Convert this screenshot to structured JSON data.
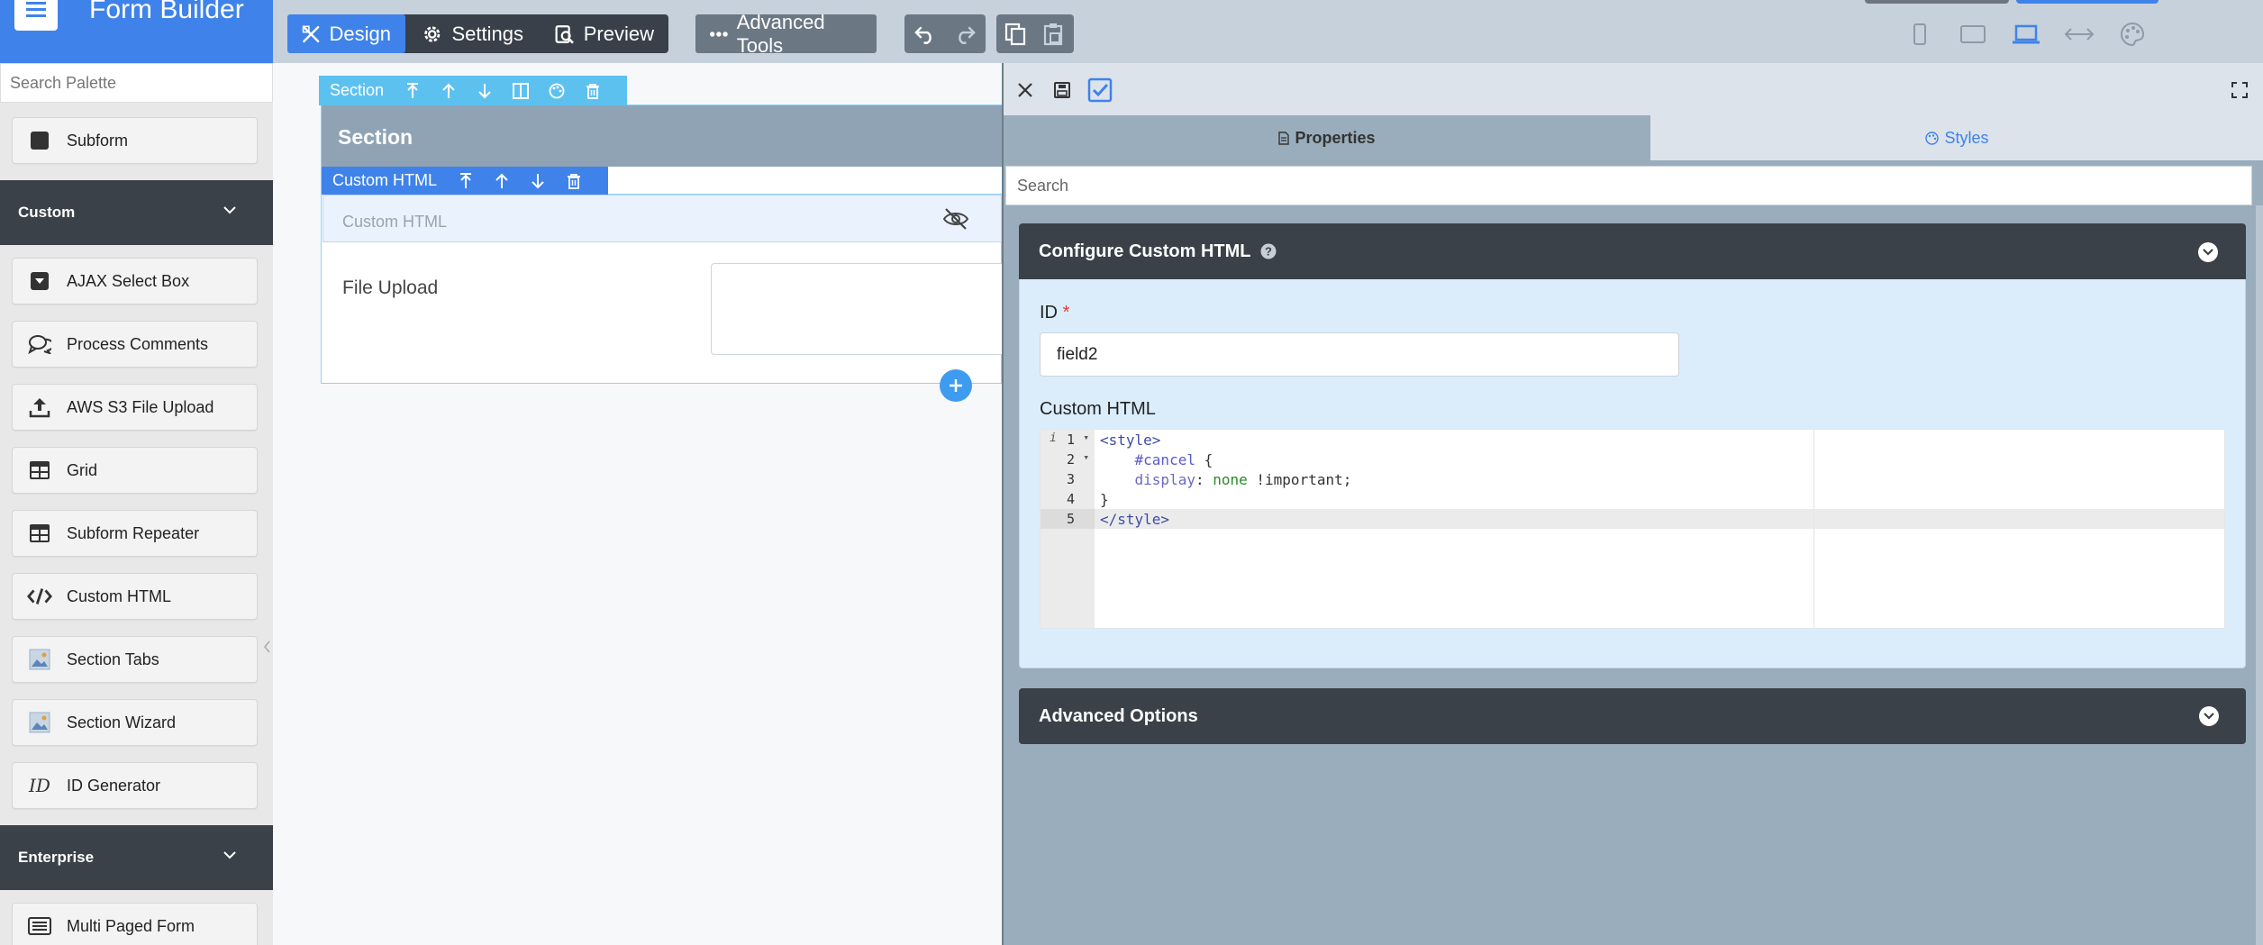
{
  "app": {
    "title": "Form Builder",
    "accent_color": "#3f83ea"
  },
  "header": {
    "design_label": "Design",
    "settings_label": "Settings",
    "preview_label": "Preview",
    "advanced_tools_label": "Advanced Tools",
    "device_icons": [
      "phone-icon",
      "tablet-icon",
      "laptop-icon",
      "full-width-icon",
      "palette-icon"
    ]
  },
  "sidebar": {
    "search_placeholder": "Search Palette",
    "subform_label": "Subform",
    "custom_header": "Custom",
    "custom_items": [
      {
        "label": "AJAX Select Box",
        "icon": "dropdown-icon"
      },
      {
        "label": "Process Comments",
        "icon": "comments-icon"
      },
      {
        "label": "AWS S3 File Upload",
        "icon": "upload-icon"
      },
      {
        "label": "Grid",
        "icon": "grid-icon"
      },
      {
        "label": "Subform Repeater",
        "icon": "table-icon"
      },
      {
        "label": "Custom HTML",
        "icon": "code-icon"
      },
      {
        "label": "Section Tabs",
        "icon": "image-icon"
      },
      {
        "label": "Section Wizard",
        "icon": "image-icon"
      },
      {
        "label": "ID Generator",
        "icon": "id-icon"
      }
    ],
    "enterprise_header": "Enterprise",
    "enterprise_items": [
      {
        "label": "Multi Paged Form",
        "icon": "list-icon"
      }
    ]
  },
  "canvas": {
    "section_toolbar_label": "Section",
    "section_title": "Section",
    "custom_html_toolbar_label": "Custom HTML",
    "custom_html_placeholder": "Custom HTML",
    "file_upload_label": "File Upload"
  },
  "panel": {
    "tab_properties": "Properties",
    "tab_styles": "Styles",
    "search_placeholder": "Search",
    "config_title": "Configure Custom HTML",
    "id_label": "ID",
    "id_required_mark": "*",
    "id_value": "field2",
    "custom_html_label": "Custom HTML",
    "code_lines": [
      {
        "num": "1",
        "text": "<style>"
      },
      {
        "num": "2",
        "text": "    #cancel {"
      },
      {
        "num": "3",
        "text": "    display: none !important;"
      },
      {
        "num": "4",
        "text": "}"
      },
      {
        "num": "5",
        "text": "</style>"
      }
    ],
    "advanced_options_title": "Advanced Options"
  }
}
